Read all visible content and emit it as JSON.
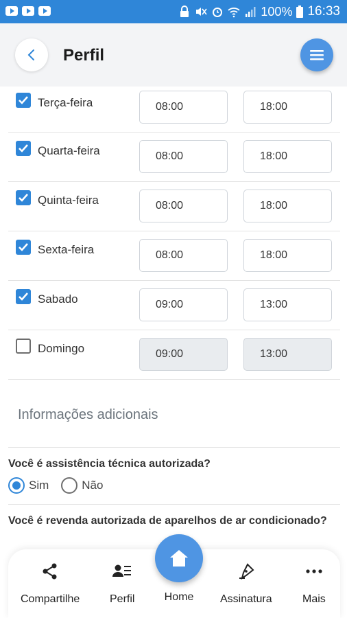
{
  "status_bar": {
    "battery": "100%",
    "time": "16:33"
  },
  "header": {
    "title": "Perfil"
  },
  "schedule": {
    "days": [
      {
        "name": "Terça-feira",
        "checked": true,
        "start": "08:00",
        "end": "18:00"
      },
      {
        "name": "Quarta-feira",
        "checked": true,
        "start": "08:00",
        "end": "18:00"
      },
      {
        "name": "Quinta-feira",
        "checked": true,
        "start": "08:00",
        "end": "18:00"
      },
      {
        "name": "Sexta-feira",
        "checked": true,
        "start": "08:00",
        "end": "18:00"
      },
      {
        "name": "Sabado",
        "checked": true,
        "start": "09:00",
        "end": "13:00"
      },
      {
        "name": "Domingo",
        "checked": false,
        "start": "09:00",
        "end": "13:00"
      }
    ]
  },
  "additional_info": {
    "section_title": "Informações adicionais",
    "q1": {
      "text": "Você é assistência técnica autorizada?",
      "options": [
        "Sim",
        "Não"
      ],
      "selected": "Sim"
    },
    "q2": {
      "text": "Você é revenda autorizada de aparelhos de ar condicionado?"
    }
  },
  "bottom_nav": {
    "share": "Compartilhe",
    "profile": "Perfil",
    "home": "Home",
    "signature": "Assinatura",
    "more": "Mais"
  },
  "colors": {
    "status_bar": "#2f86d8",
    "accent": "#4f95e3",
    "checkbox": "#2f86d8"
  }
}
